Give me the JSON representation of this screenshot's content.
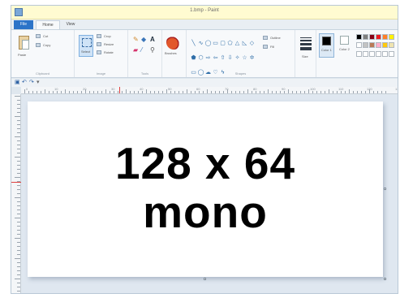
{
  "window": {
    "title": "1.bmp - Paint"
  },
  "tabs": [
    {
      "label": "File"
    },
    {
      "label": "Home"
    },
    {
      "label": "View"
    }
  ],
  "clipboard": {
    "paste_label": "Paste",
    "cut_label": "Cut",
    "copy_label": "Copy",
    "group_label": "Clipboard"
  },
  "image": {
    "select_label": "Select",
    "crop_label": "Crop",
    "resize_label": "Resize",
    "rotate_label": "Rotate",
    "group_label": "Image"
  },
  "tools": {
    "group_label": "Tools"
  },
  "brushes": {
    "label": "Brushes"
  },
  "shapes": {
    "outline_label": "Outline",
    "fill_label": "Fill",
    "group_label": "Shapes"
  },
  "size": {
    "label": "Size"
  },
  "colors": {
    "color1_label": "Color 1",
    "color2_label": "Color 2",
    "color1": "#000000",
    "color2": "#ffffff",
    "palette": [
      "#000000",
      "#7f7f7f",
      "#880015",
      "#ed1c24",
      "#ff7f27",
      "#fff200",
      "#ffffff",
      "#c3c3c3",
      "#b97a57",
      "#ffaec9",
      "#ffc90e",
      "#efe4b0",
      "#ffffff",
      "#ffffff",
      "#ffffff",
      "#ffffff",
      "#ffffff",
      "#ffffff"
    ]
  },
  "ruler": {
    "labels": [
      "0",
      "10",
      "20",
      "30",
      "40",
      "50",
      "60",
      "70",
      "80",
      "90",
      "100",
      "110",
      "120",
      "130"
    ]
  },
  "canvas": {
    "line1": "128 x 64",
    "line2": "mono"
  }
}
